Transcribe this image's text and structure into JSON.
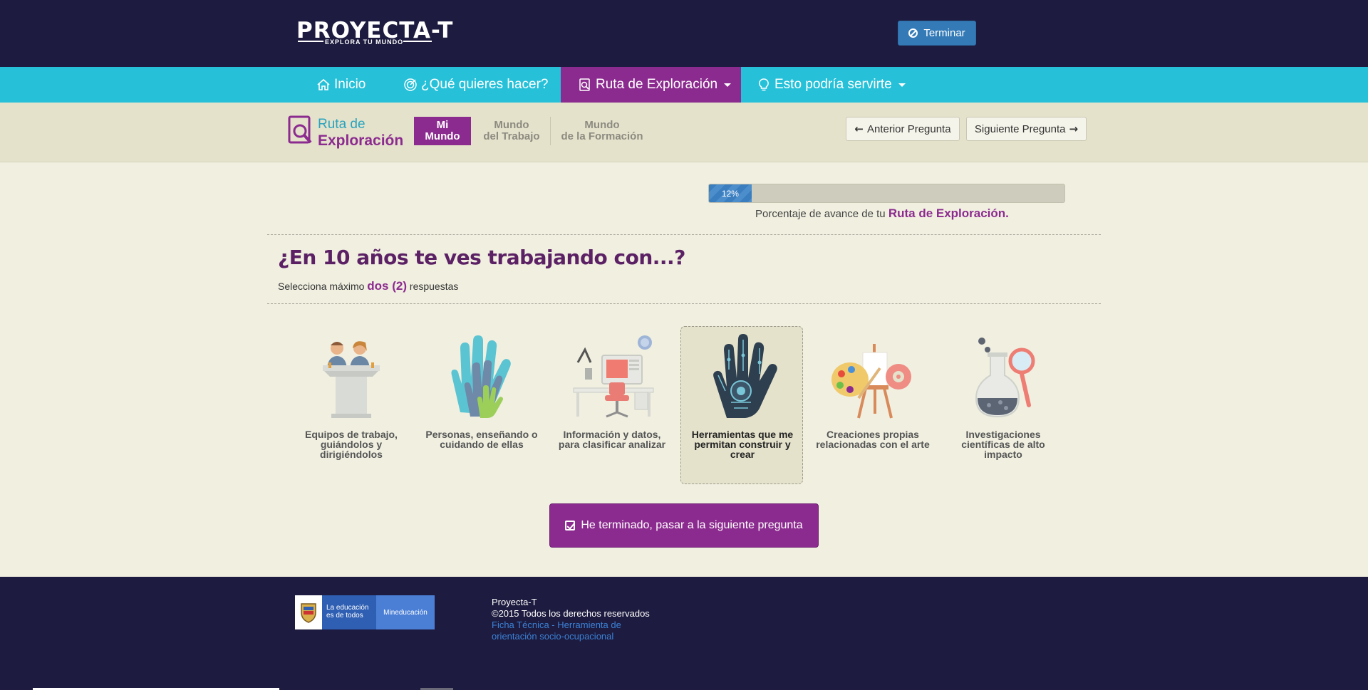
{
  "header": {
    "logo_text": "PROYECTA-T",
    "logo_tagline": "EXPLORA TU MUNDO",
    "finish_label": "Terminar"
  },
  "nav": {
    "items": [
      {
        "label": "Inicio",
        "icon": "home-icon"
      },
      {
        "label": "¿Qué quieres hacer?",
        "icon": "target-icon"
      },
      {
        "label": "Ruta de Exploración",
        "icon": "search-document-icon",
        "active": true
      },
      {
        "label": "Esto podría servirte",
        "icon": "lightbulb-icon"
      }
    ]
  },
  "subheader": {
    "title_line1": "Ruta de",
    "title_line2": "Exploración",
    "steps": [
      {
        "label_line1": "Mi",
        "label_line2": "Mundo",
        "active": true
      },
      {
        "label_line1": "Mundo",
        "label_line2": "del Trabajo"
      },
      {
        "label_line1": "Mundo",
        "label_line2": "de la Formación"
      }
    ],
    "prev_label": "Anterior Pregunta",
    "next_label": "Siguiente Pregunta"
  },
  "progress": {
    "percent": 12,
    "percent_label": "12%",
    "caption_prefix": "Porcentaje de avance de tu",
    "caption_highlight": "Ruta de Exploración."
  },
  "question": {
    "title": "¿En 10 años te ves trabajando con...?",
    "instruction_prefix": "Selecciona máximo",
    "instruction_highlight": "dos (2)",
    "instruction_suffix": "respuestas"
  },
  "options": [
    {
      "label": "Equipos de trabajo, guiándolos y dirigiéndolos",
      "icon": "team-podium-icon"
    },
    {
      "label": "Personas, enseñando o cuidando de ellas",
      "icon": "hands-icon"
    },
    {
      "label": "Información y datos, para clasificar analizar",
      "icon": "desk-computer-icon"
    },
    {
      "label": "Herramientas que me permitan construir y crear",
      "icon": "robot-hand-icon",
      "selected": true
    },
    {
      "label": "Creaciones propias relacionadas con el arte",
      "icon": "palette-easel-icon"
    },
    {
      "label": "Investigaciones científicas de alto impacto",
      "icon": "flask-magnifier-icon"
    }
  ],
  "submit_label": "He terminado, pasar a la siguiente pregunta",
  "footer": {
    "logo_slogan_line1": "La educación",
    "logo_slogan_line2": "es de todos",
    "logo_ministry": "Mineducación",
    "name": "Proyecta-T",
    "copyright": "©2015 Todos los derechos reservados",
    "link": "Ficha Técnica - Herramienta de orientación socio-ocupacional"
  },
  "colors": {
    "header_bg": "#1d1b3f",
    "nav_bg": "#26c1d9",
    "accent_purple": "#8c2b8f",
    "button_blue": "#337ab7",
    "page_bg": "#f0efe0"
  }
}
